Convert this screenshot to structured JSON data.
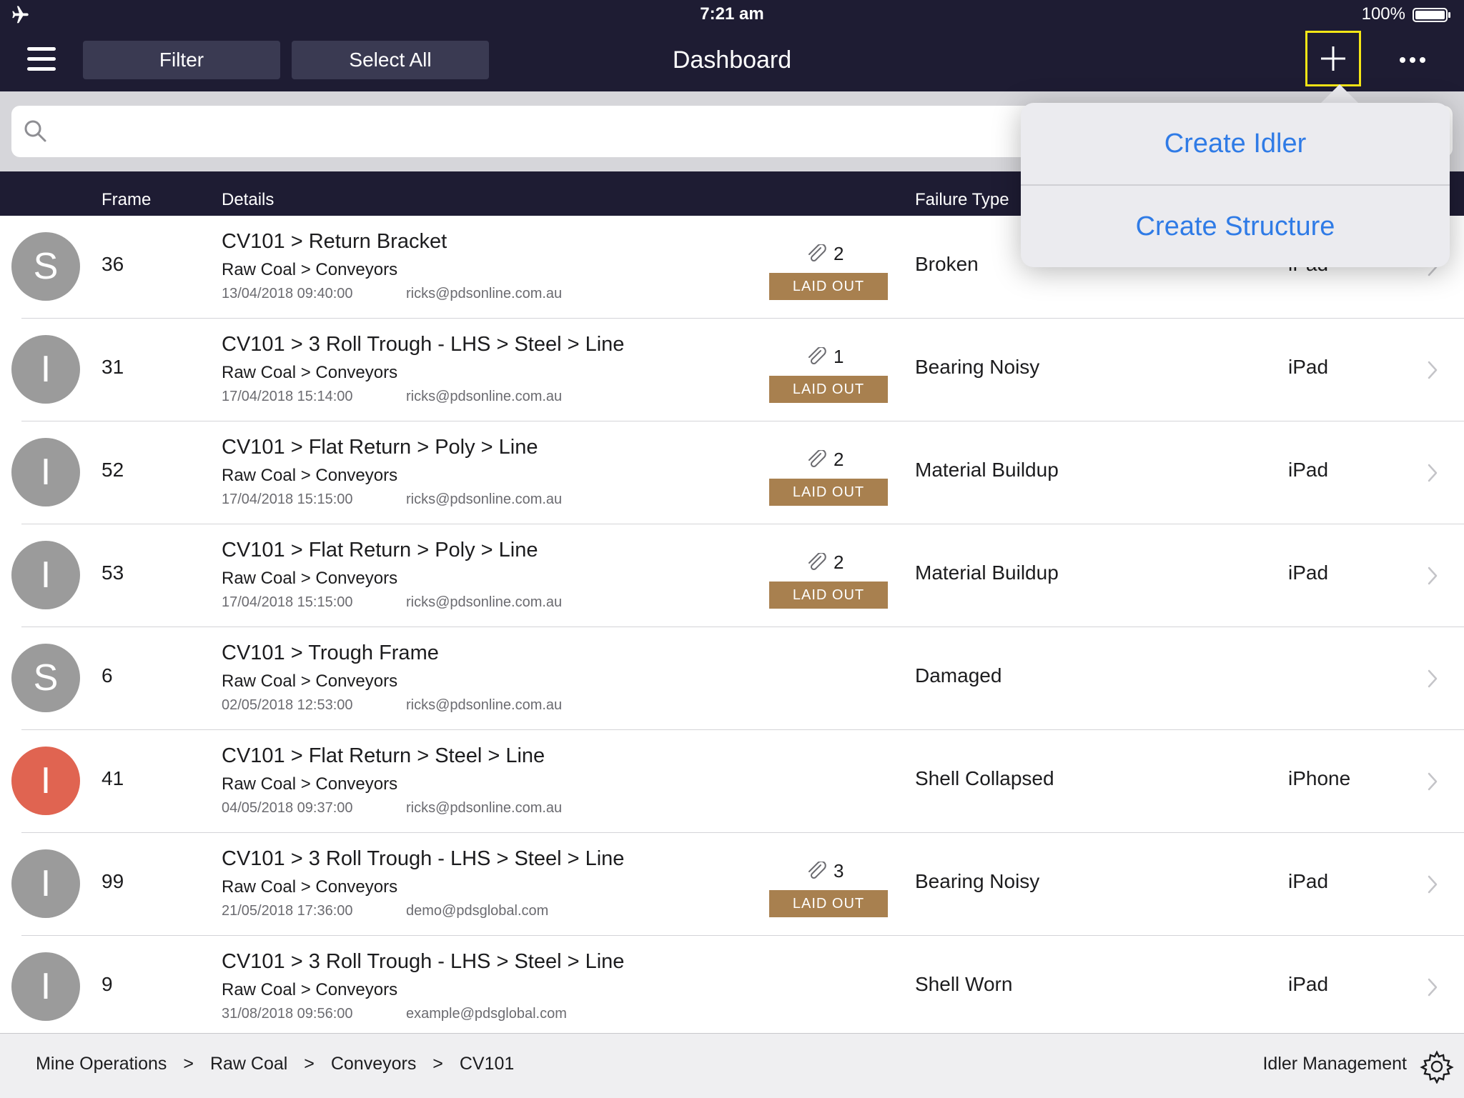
{
  "status_bar": {
    "time": "7:21 am",
    "battery": "100%",
    "airplane_icon": "airplane-icon",
    "battery_icon": "battery-icon"
  },
  "nav": {
    "menu_icon": "hamburger-menu-icon",
    "filter_label": "Filter",
    "select_all_label": "Select All",
    "title": "Dashboard",
    "add_icon": "plus-icon",
    "more_icon": "ellipsis-icon"
  },
  "search": {
    "placeholder": "",
    "value": "",
    "icon": "search-icon"
  },
  "table": {
    "headers": {
      "frame": "Frame",
      "details": "Details",
      "failure_type": "Failure Type"
    },
    "rows": [
      {
        "initial": "S",
        "frame": "36",
        "title": "CV101 > Return Bracket",
        "subtitle": "Raw Coal > Conveyors",
        "date": "13/04/2018 09:40:00",
        "email": "ricks@pdsonline.com.au",
        "attachments": "2",
        "status": "LAID OUT",
        "failure": "Broken",
        "device": "iPad",
        "highlight": false
      },
      {
        "initial": "I",
        "frame": "31",
        "title": "CV101 > 3 Roll Trough - LHS > Steel > Line",
        "subtitle": "Raw Coal > Conveyors",
        "date": "17/04/2018 15:14:00",
        "email": "ricks@pdsonline.com.au",
        "attachments": "1",
        "status": "LAID OUT",
        "failure": "Bearing Noisy",
        "device": "iPad",
        "highlight": false
      },
      {
        "initial": "I",
        "frame": "52",
        "title": "CV101 > Flat Return > Poly > Line",
        "subtitle": "Raw Coal > Conveyors",
        "date": "17/04/2018 15:15:00",
        "email": "ricks@pdsonline.com.au",
        "attachments": "2",
        "status": "LAID OUT",
        "failure": "Material Buildup",
        "device": "iPad",
        "highlight": false
      },
      {
        "initial": "I",
        "frame": "53",
        "title": "CV101 > Flat Return > Poly > Line",
        "subtitle": "Raw Coal > Conveyors",
        "date": "17/04/2018 15:15:00",
        "email": "ricks@pdsonline.com.au",
        "attachments": "2",
        "status": "LAID OUT",
        "failure": "Material Buildup",
        "device": "iPad",
        "highlight": false
      },
      {
        "initial": "S",
        "frame": "6",
        "title": "CV101 > Trough Frame",
        "subtitle": "Raw Coal > Conveyors",
        "date": "02/05/2018 12:53:00",
        "email": "ricks@pdsonline.com.au",
        "attachments": "",
        "status": "",
        "failure": "Damaged",
        "device": "",
        "highlight": false
      },
      {
        "initial": "I",
        "frame": "41",
        "title": "CV101 > Flat Return > Steel > Line",
        "subtitle": "Raw Coal > Conveyors",
        "date": "04/05/2018 09:37:00",
        "email": "ricks@pdsonline.com.au",
        "attachments": "",
        "status": "",
        "failure": "Shell Collapsed",
        "device": "iPhone",
        "highlight": true
      },
      {
        "initial": "I",
        "frame": "99",
        "title": "CV101 > 3 Roll Trough - LHS > Steel > Line",
        "subtitle": "Raw Coal > Conveyors",
        "date": "21/05/2018 17:36:00",
        "email": "demo@pdsglobal.com",
        "attachments": "3",
        "status": "LAID OUT",
        "failure": "Bearing Noisy",
        "device": "iPad",
        "highlight": false
      },
      {
        "initial": "I",
        "frame": "9",
        "title": "CV101 > 3 Roll Trough - LHS > Steel > Line",
        "subtitle": "Raw Coal > Conveyors",
        "date": "31/08/2018 09:56:00",
        "email": "example@pdsglobal.com",
        "attachments": "",
        "status": "",
        "failure": "Shell Worn",
        "device": "iPad",
        "highlight": false
      }
    ]
  },
  "popover": {
    "items": [
      "Create Idler",
      "Create Structure"
    ]
  },
  "footer": {
    "breadcrumb": [
      "Mine Operations",
      "Raw Coal",
      "Conveyors",
      "CV101"
    ],
    "breadcrumb_separator": ">",
    "app_label": "Idler Management",
    "settings_icon": "gear-icon"
  },
  "colors": {
    "nav_background": "#1e1c33",
    "badge": "#a8804f",
    "accent_link": "#2f7be6",
    "avatar_default": "#9b9b9b",
    "avatar_alert": "#e06451",
    "focus_outline": "#f5e616"
  }
}
